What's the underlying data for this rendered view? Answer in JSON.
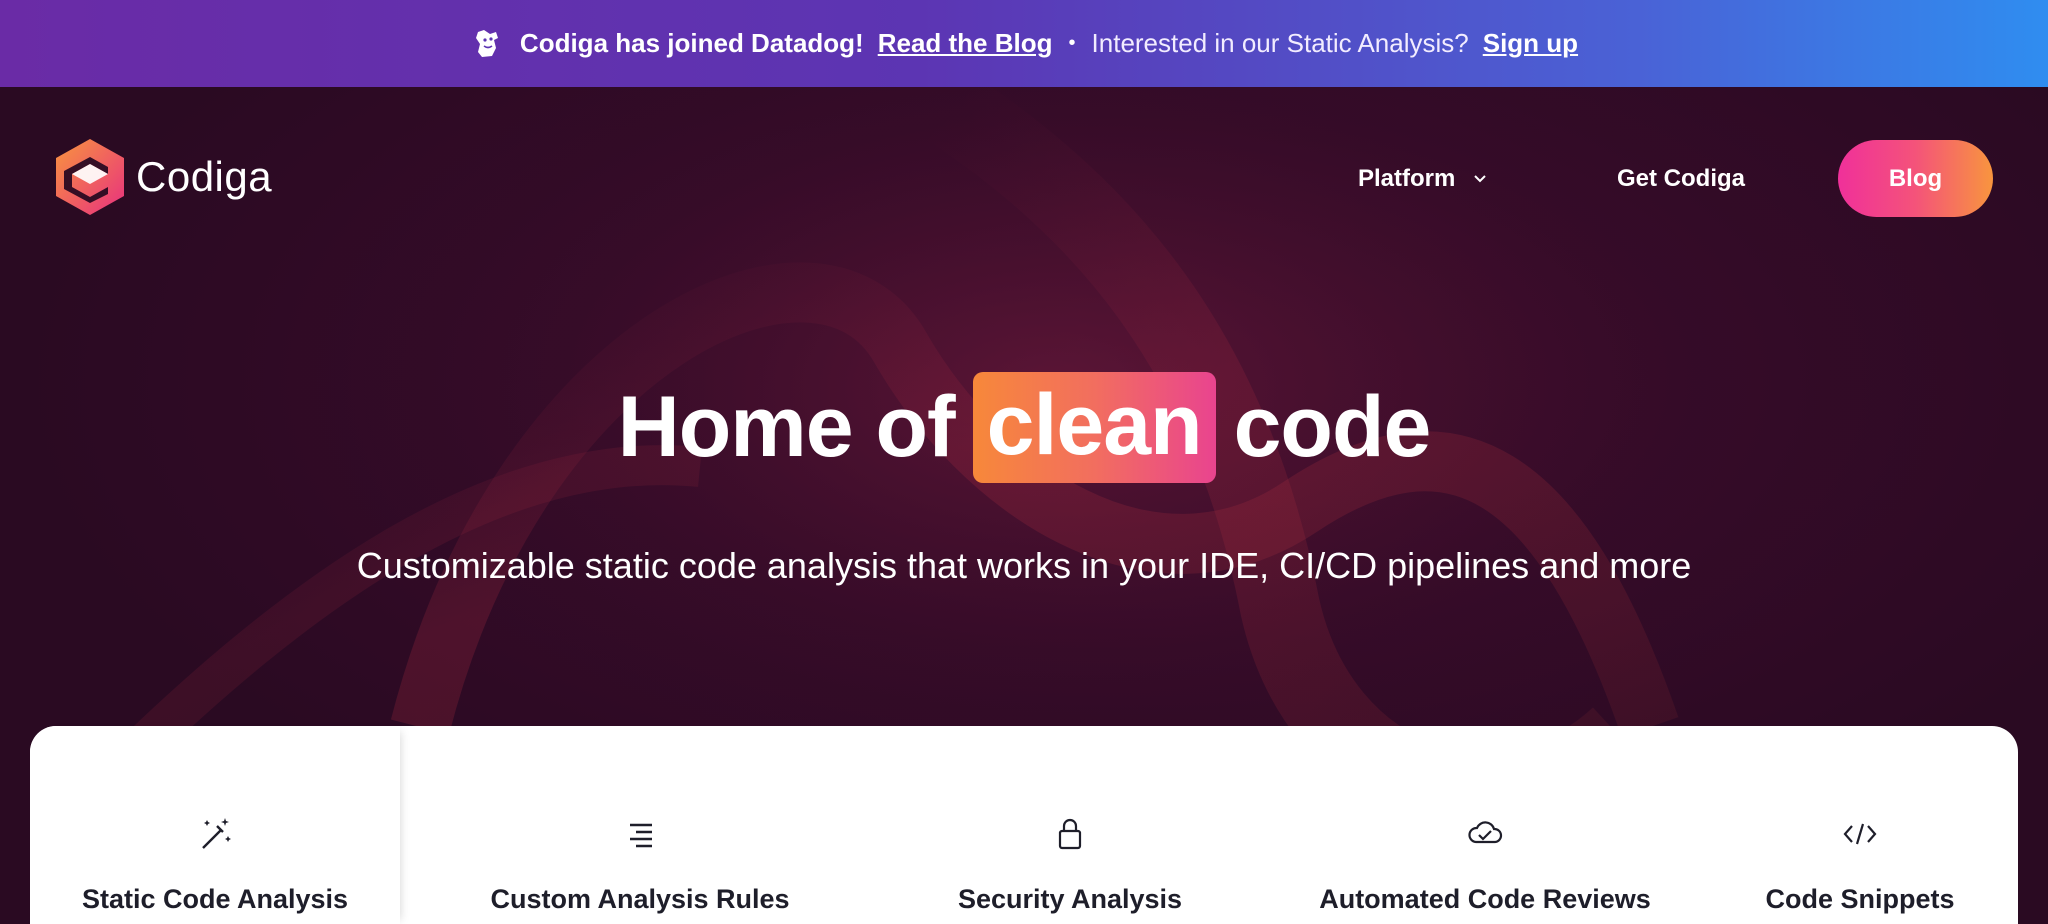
{
  "banner": {
    "icon": "datadog-icon",
    "announcement": "Codiga has joined Datadog!",
    "blog_link": "Read the Blog",
    "separator": "•",
    "question": "Interested in our Static Analysis?",
    "signup_link": "Sign up"
  },
  "nav": {
    "brand": "Codiga",
    "platform": "Platform",
    "get_codiga": "Get Codiga",
    "blog": "Blog"
  },
  "hero": {
    "title_before": "Home of",
    "title_highlight": "clean",
    "title_after": "code",
    "subtitle": "Customizable static code analysis that works in your IDE, CI/CD pipelines and more"
  },
  "features": [
    {
      "label": "Static Code Analysis",
      "icon": "magic-wand-icon"
    },
    {
      "label": "Custom Analysis Rules",
      "icon": "lines-icon"
    },
    {
      "label": "Security Analysis",
      "icon": "lock-icon"
    },
    {
      "label": "Automated Code Reviews",
      "icon": "cloud-check-icon"
    },
    {
      "label": "Code Snippets",
      "icon": "code-icon"
    }
  ],
  "colors": {
    "banner_gradient_start": "#6a2ba6",
    "banner_gradient_end": "#2f8df0",
    "hero_bg": "#2a0a22",
    "accent_orange": "#f7883a",
    "accent_pink": "#f0309a"
  }
}
